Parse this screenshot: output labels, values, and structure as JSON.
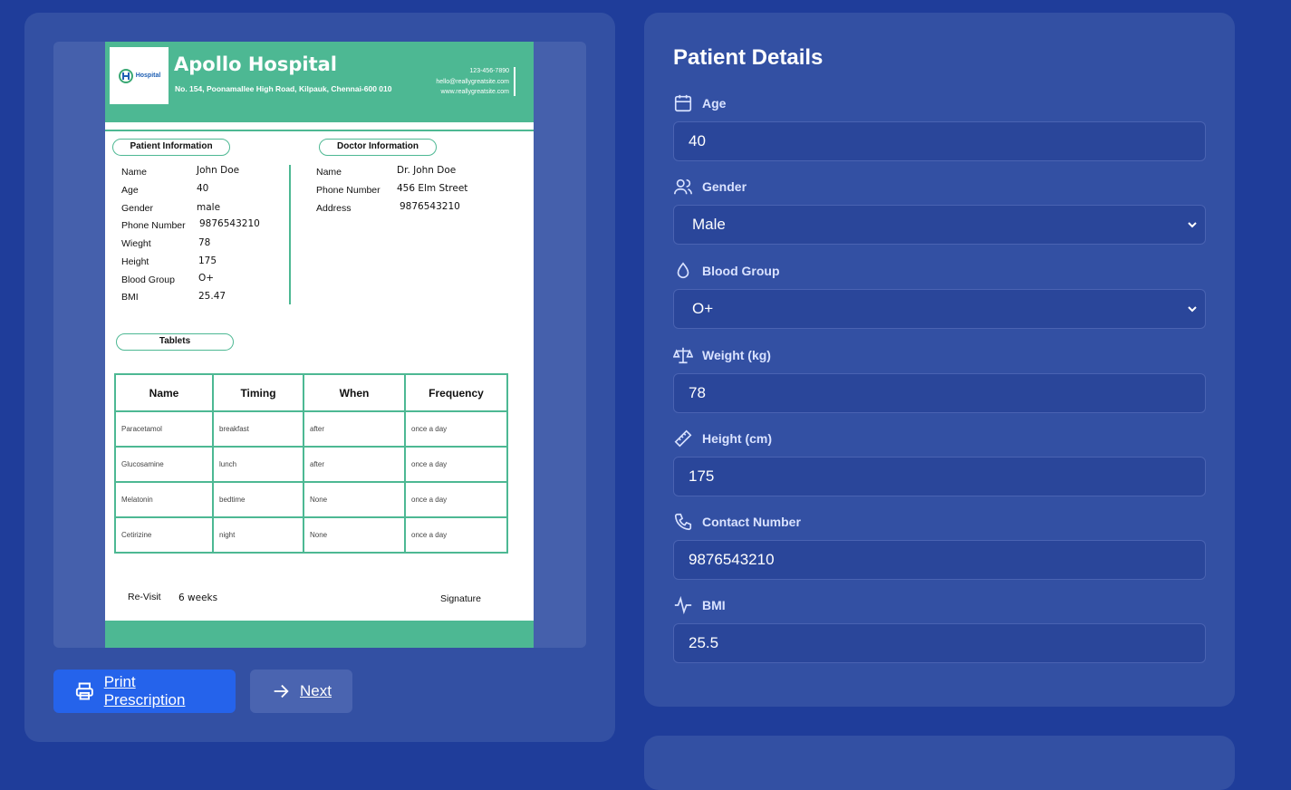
{
  "prescription": {
    "logo_text": "Hospital",
    "hospital_name": "Apollo Hospital",
    "address": "No. 154, Poonamallee High Road, Kilpauk, Chennai-600 010",
    "phone": "123-456-7890",
    "email": "hello@reallygreatsite.com",
    "website": "www.reallygreatsite.com",
    "patient_info_heading": "Patient Information",
    "doctor_info_heading": "Doctor Information",
    "patient": {
      "name_label": "Name",
      "name": "John Doe",
      "age_label": "Age",
      "age": "40",
      "gender_label": "Gender",
      "gender": "male",
      "phone_label": "Phone Number",
      "phone": "9876543210",
      "weight_label": "Wieght",
      "weight": "78",
      "height_label": "Height",
      "height": "175",
      "blood_label": "Blood Group",
      "blood": "O+",
      "bmi_label": "BMI",
      "bmi": "25.47"
    },
    "doctor": {
      "name_label": "Name",
      "name": "Dr. John Doe",
      "phone_label": "Phone Number",
      "phone": "456 Elm Street",
      "address_label": "Address",
      "address": "9876543210"
    },
    "tablets_heading": "Tablets",
    "table": {
      "headers": [
        "Name",
        "Timing",
        "When",
        "Frequency"
      ],
      "rows": [
        [
          "Paracetamol",
          "breakfast",
          "after",
          "once a day"
        ],
        [
          "Glucosamine",
          "lunch",
          "after",
          "once a day"
        ],
        [
          "Melatonin",
          "bedtime",
          "None",
          "once a day"
        ],
        [
          "Cetirizine",
          "night",
          "None",
          "once a day"
        ]
      ]
    },
    "revisit_label": "Re-Visit",
    "revisit_value": "6 weeks",
    "signature_label": "Signature"
  },
  "actions": {
    "print_label": "Print Prescription",
    "next_label": "Next"
  },
  "patient_details": {
    "title": "Patient Details",
    "age": {
      "label": "Age",
      "value": "40",
      "icon": "calendar-icon"
    },
    "gender": {
      "label": "Gender",
      "value": "Male",
      "icon": "users-icon"
    },
    "blood_group": {
      "label": "Blood Group",
      "value": "O+",
      "icon": "droplet-icon"
    },
    "weight": {
      "label": "Weight (kg)",
      "value": "78",
      "icon": "scale-icon"
    },
    "height": {
      "label": "Height (cm)",
      "value": "175",
      "icon": "ruler-icon"
    },
    "contact": {
      "label": "Contact Number",
      "value": "9876543210",
      "icon": "phone-icon"
    },
    "bmi": {
      "label": "BMI",
      "value": "25.5",
      "icon": "activity-icon"
    }
  },
  "colors": {
    "background": "#1f3d9a",
    "panel": "#3350a3",
    "accent_green": "#4db893",
    "primary_button": "#2563eb"
  }
}
